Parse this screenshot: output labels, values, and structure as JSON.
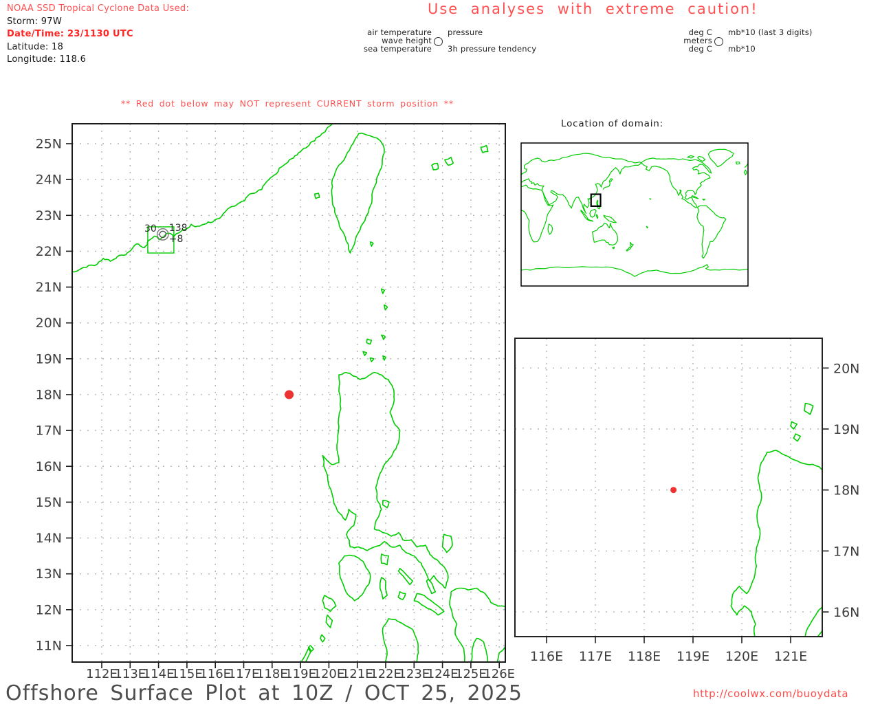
{
  "header": {
    "source_line": "NOAA SSD Tropical Cyclone Data Used:",
    "storm_line": "Storm: 97W",
    "datetime_line": "Date/Time: 23/1130 UTC",
    "latitude_line": "Latitude: 18",
    "longitude_line": "Longitude: 118.6"
  },
  "caution_title": "Use analyses with extreme caution!",
  "station_legend": {
    "rows": [
      {
        "left": "air temperature",
        "right": "pressure"
      },
      {
        "left": "wave height",
        "right": ""
      },
      {
        "left": "sea temperature",
        "right": "3h pressure tendency"
      }
    ]
  },
  "units_legend": {
    "rows": [
      {
        "left": "deg C",
        "right": "mb*10 (last 3 digits)"
      },
      {
        "left": "meters",
        "right": ""
      },
      {
        "left": "deg C",
        "right": "mb*10"
      }
    ]
  },
  "warning_line": "** Red dot below may NOT represent CURRENT storm position **",
  "main_map": {
    "lon_labels": [
      "112E",
      "113E",
      "114E",
      "115E",
      "116E",
      "117E",
      "118E",
      "119E",
      "120E",
      "121E",
      "122E",
      "123E",
      "124E",
      "125E",
      "126E"
    ],
    "lat_labels": [
      "25N",
      "24N",
      "23N",
      "22N",
      "21N",
      "20N",
      "19N",
      "18N",
      "17N",
      "16N",
      "15N",
      "14N",
      "13N",
      "12N",
      "11N"
    ],
    "storm_dot": {
      "lon": 118.6,
      "lat": 18
    },
    "station": {
      "lon": 114.15,
      "lat": 22.47,
      "air_temp": "30",
      "pressure": "138",
      "tendency_3h": "+8"
    }
  },
  "domain_inset": {
    "title": "Location of domain:"
  },
  "zoom_map": {
    "lon_labels": [
      "116E",
      "117E",
      "118E",
      "119E",
      "120E",
      "121E"
    ],
    "lat_labels": [
      "20N",
      "19N",
      "18N",
      "17N",
      "16N"
    ],
    "storm_dot": {
      "lon": 118.6,
      "lat": 18
    }
  },
  "footer": {
    "title": "Offshore Surface Plot at 10Z / OCT 25, 2025",
    "url": "http://coolwx.com/buoydata"
  },
  "colors": {
    "coast_green": "#00cc00",
    "alert_red": "#ff5050",
    "bold_red": "#ff2424",
    "dot_red": "#ee3232",
    "grid_gray": "#b5b5b5",
    "axis_label": "#3d3d3d",
    "border_dark": "#1a1a1a",
    "station_gray": "#777777",
    "title_gray": "#4d4d4d"
  }
}
